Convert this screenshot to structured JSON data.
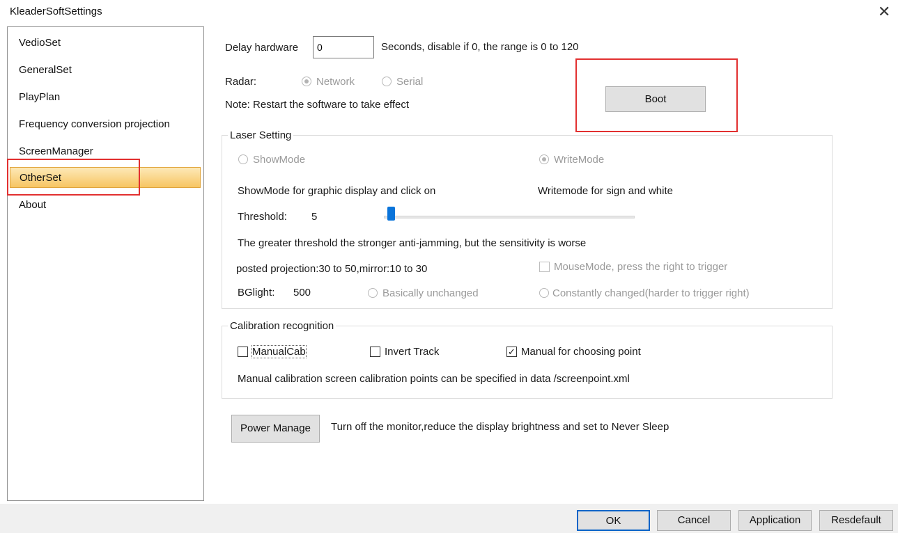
{
  "window": {
    "title": "KleaderSoftSettings",
    "close_glyph": "✕"
  },
  "sidebar": {
    "items": [
      {
        "label": "VedioSet"
      },
      {
        "label": "GeneralSet"
      },
      {
        "label": "PlayPlan"
      },
      {
        "label": "Frequency conversion projection"
      },
      {
        "label": "ScreenManager"
      },
      {
        "label": "OtherSet",
        "selected": true
      },
      {
        "label": "About"
      }
    ]
  },
  "main": {
    "delay": {
      "label": "Delay hardware",
      "value": "0",
      "hint": "Seconds, disable if 0, the range is 0 to 120"
    },
    "radar": {
      "label": "Radar:",
      "options": [
        "Network",
        "Serial"
      ],
      "selected": "Network"
    },
    "note": "Note: Restart the software to take effect",
    "boot_button": "Boot",
    "laser": {
      "legend": "Laser Setting",
      "show_mode": "ShowMode",
      "write_mode": "WriteMode",
      "selected_mode": "WriteMode",
      "show_mode_desc": "ShowMode for graphic display and click on",
      "write_mode_desc": "Writemode for sign and white",
      "threshold_label": "Threshold:",
      "threshold_value": "5",
      "threshold_note": "The greater threshold the stronger anti-jamming, but the sensitivity is worse",
      "posted_projection": "posted projection:30 to 50,mirror:10 to 30",
      "mouse_mode": "MouseMode, press the right to trigger",
      "bglight_label": "BGlight:",
      "bglight_value": "500",
      "basically_unchanged": "Basically unchanged",
      "constantly_changed": "Constantly changed(harder to trigger right)"
    },
    "calibration": {
      "legend": "Calibration recognition",
      "manual_cab": "ManualCab",
      "manual_cab_checked": false,
      "invert_track": "Invert Track",
      "invert_track_checked": false,
      "manual_point": "Manual for choosing point",
      "manual_point_checked": true,
      "note": "Manual calibration screen calibration points can be specified in data /screenpoint.xml"
    },
    "power": {
      "button": "Power Manage",
      "desc": "Turn off the monitor,reduce the display brightness and set to Never Sleep"
    }
  },
  "footer": {
    "ok": "OK",
    "cancel": "Cancel",
    "application": "Application",
    "resdefault": "Resdefault"
  },
  "colors": {
    "highlight_box": "#e23030",
    "selected_item": "#f7c562",
    "slider_thumb": "#0a74da"
  }
}
